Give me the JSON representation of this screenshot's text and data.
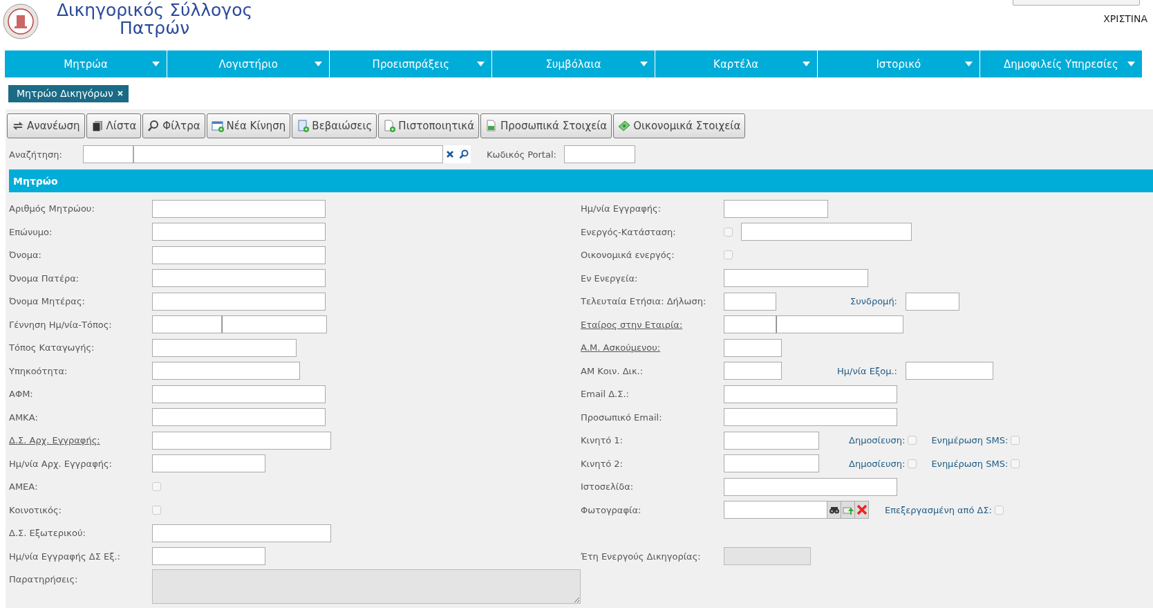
{
  "header": {
    "title_line1": "Δικηγορικός Σύλλογος",
    "title_line2": "Πατρών",
    "user": "ΧΡΙΣΤΙΝΑ"
  },
  "menu": [
    {
      "label": "Μητρώα"
    },
    {
      "label": "Λογιστήριο"
    },
    {
      "label": "Προεισπράξεις"
    },
    {
      "label": "Συμβόλαια"
    },
    {
      "label": "Καρτέλα"
    },
    {
      "label": "Ιστορικό"
    },
    {
      "label": "Δημοφιλείς Υπηρεσίες"
    }
  ],
  "open_tabs": [
    {
      "label": "Μητρώο Δικηγόρων",
      "selected": true
    }
  ],
  "toolbar": [
    {
      "label": "Ανανέωση",
      "kind": "refresh"
    },
    {
      "label": "Λίστα",
      "kind": "list"
    },
    {
      "label": "Φίλτρα",
      "kind": "filter"
    },
    {
      "label": "Νέα Κίνηση",
      "kind": "new"
    },
    {
      "label": "Βεβαιώσεις",
      "kind": "attest"
    },
    {
      "label": "Πιστοποιητικά",
      "kind": "certificate"
    },
    {
      "label": "Προσωπικά Στοιχεία",
      "kind": "personal"
    },
    {
      "label": "Οικονομικά Στοιχεία",
      "kind": "money"
    }
  ],
  "search": {
    "label": "Αναζήτηση:",
    "portal_label": "Κωδικός Portal:"
  },
  "section": {
    "title": "Μητρώο"
  },
  "rows": [
    {
      "left": {
        "label": "Αριθμός Μητρώου:",
        "link": false,
        "controls": [
          {
            "kind": "input",
            "disabled": false
          }
        ]
      },
      "right": {
        "label": "Ημ/νία Εγγραφής:",
        "link": false,
        "controls": [
          {
            "kind": "input",
            "disabled": false
          }
        ]
      }
    },
    {
      "left": {
        "label": "Επώνυμο:",
        "link": false,
        "controls": [
          {
            "kind": "input",
            "disabled": false
          }
        ]
      },
      "right": {
        "label": "Ενεργός-Κατάσταση:",
        "link": false,
        "controls": [
          {
            "kind": "checkbox",
            "checked": false
          },
          {
            "kind": "input",
            "disabled": false
          }
        ]
      }
    },
    {
      "left": {
        "label": "Όνομα:",
        "link": false,
        "controls": [
          {
            "kind": "input",
            "disabled": false
          }
        ]
      },
      "right": {
        "label": "Οικονομικά ενεργός:",
        "link": false,
        "controls": [
          {
            "kind": "checkbox",
            "checked": false
          }
        ]
      }
    },
    {
      "left": {
        "label": "Όνομα Πατέρα:",
        "link": false,
        "controls": [
          {
            "kind": "input",
            "disabled": false
          }
        ]
      },
      "right": {
        "label": "Εν Ενεργεία:",
        "link": false,
        "controls": [
          {
            "kind": "input",
            "disabled": false
          }
        ]
      }
    },
    {
      "left": {
        "label": "Όνομα Μητέρας:",
        "link": false,
        "controls": [
          {
            "kind": "input",
            "disabled": false
          }
        ]
      },
      "right": {
        "label": "Τελευταία Ετήσια: Δήλωση:",
        "link": false,
        "controls": [
          {
            "kind": "input",
            "disabled": false
          },
          {
            "kind": "label",
            "text": "Συνδρομή:"
          },
          {
            "kind": "input",
            "disabled": false
          }
        ]
      }
    },
    {
      "left": {
        "label": "Γέννηση Ημ/νία-Τόπος:",
        "link": false,
        "controls": [
          {
            "kind": "input",
            "disabled": false
          },
          {
            "kind": "input",
            "disabled": false
          }
        ]
      },
      "right": {
        "label": "Εταίρος στην Εταιρία:",
        "link": true,
        "controls": [
          {
            "kind": "input",
            "disabled": false
          },
          {
            "kind": "input",
            "disabled": false
          }
        ]
      }
    },
    {
      "left": {
        "label": "Τόπος Καταγωγής:",
        "link": false,
        "controls": [
          {
            "kind": "input",
            "disabled": false
          }
        ]
      },
      "right": {
        "label": "Α.Μ. Ασκούμενου:",
        "link": true,
        "controls": [
          {
            "kind": "input",
            "disabled": false
          }
        ]
      }
    },
    {
      "left": {
        "label": "Υπηκοότητα:",
        "link": false,
        "controls": [
          {
            "kind": "input",
            "disabled": false
          }
        ]
      },
      "right": {
        "label": "ΑΜ Κοιν. Δικ.:",
        "link": false,
        "controls": [
          {
            "kind": "input",
            "disabled": false
          },
          {
            "kind": "label",
            "text": "Ημ/νία Εξομ.:"
          },
          {
            "kind": "input",
            "disabled": false
          }
        ]
      }
    },
    {
      "left": {
        "label": "ΑΦΜ:",
        "link": false,
        "controls": [
          {
            "kind": "input",
            "disabled": false
          }
        ]
      },
      "right": {
        "label": "Email Δ.Σ.:",
        "link": false,
        "controls": [
          {
            "kind": "input",
            "disabled": false
          }
        ]
      }
    },
    {
      "left": {
        "label": "ΑΜΚΑ:",
        "link": false,
        "controls": [
          {
            "kind": "input",
            "disabled": false
          }
        ]
      },
      "right": {
        "label": "Προσωπικό Email:",
        "link": false,
        "controls": [
          {
            "kind": "input",
            "disabled": false
          }
        ]
      }
    },
    {
      "left": {
        "label": "Δ.Σ. Αρχ. Εγγραφής:",
        "link": true,
        "controls": [
          {
            "kind": "input",
            "disabled": false
          }
        ]
      },
      "right": {
        "label": "Κινητό 1:",
        "link": false,
        "controls": [
          {
            "kind": "input",
            "disabled": false
          },
          {
            "kind": "label",
            "text": "Δημοσίευση:"
          },
          {
            "kind": "checkbox",
            "checked": false
          },
          {
            "kind": "label",
            "text": "Ενημέρωση SMS:"
          },
          {
            "kind": "checkbox",
            "checked": false
          }
        ]
      }
    },
    {
      "left": {
        "label": "Ημ/νία Αρχ. Εγγραφής:",
        "link": false,
        "controls": [
          {
            "kind": "input",
            "disabled": false
          }
        ]
      },
      "right": {
        "label": "Κινητό 2:",
        "link": false,
        "controls": [
          {
            "kind": "input",
            "disabled": false
          },
          {
            "kind": "label",
            "text": "Δημοσίευση:"
          },
          {
            "kind": "checkbox",
            "checked": false
          },
          {
            "kind": "label",
            "text": "Ενημέρωση SMS:"
          },
          {
            "kind": "checkbox",
            "checked": false
          }
        ]
      }
    },
    {
      "left": {
        "label": "ΑΜΕΑ:",
        "link": false,
        "controls": [
          {
            "kind": "checkbox",
            "checked": false
          }
        ]
      },
      "right": {
        "label": "Ιστοσελίδα:",
        "link": false,
        "controls": [
          {
            "kind": "input",
            "disabled": false
          }
        ]
      }
    },
    {
      "left": {
        "label": "Κοινοτικός:",
        "link": false,
        "controls": [
          {
            "kind": "checkbox",
            "checked": false
          }
        ]
      },
      "right": {
        "label": "Φωτογραφία:",
        "link": false,
        "controls": [
          {
            "kind": "photo"
          },
          {
            "kind": "label",
            "text": "Επεξεργασμένη από ΔΣ:"
          },
          {
            "kind": "checkbox",
            "checked": false
          }
        ]
      }
    },
    {
      "left": {
        "label": "Δ.Σ. Εξωτερικού:",
        "link": false,
        "controls": [
          {
            "kind": "input",
            "disabled": false
          }
        ]
      }
    },
    {
      "left": {
        "label": "Ημ/νία Εγγραφής ΔΣ Εξ.:",
        "link": false,
        "controls": [
          {
            "kind": "input",
            "disabled": false
          }
        ]
      },
      "right": {
        "label": "Έτη Ενεργούς Δικηγορίας:",
        "link": false,
        "controls": [
          {
            "kind": "input",
            "disabled": true
          }
        ]
      }
    },
    {
      "left": {
        "label": "Παρατηρήσεις:",
        "link": false,
        "controls": [
          {
            "kind": "textarea",
            "disabled": true
          }
        ]
      }
    }
  ]
}
